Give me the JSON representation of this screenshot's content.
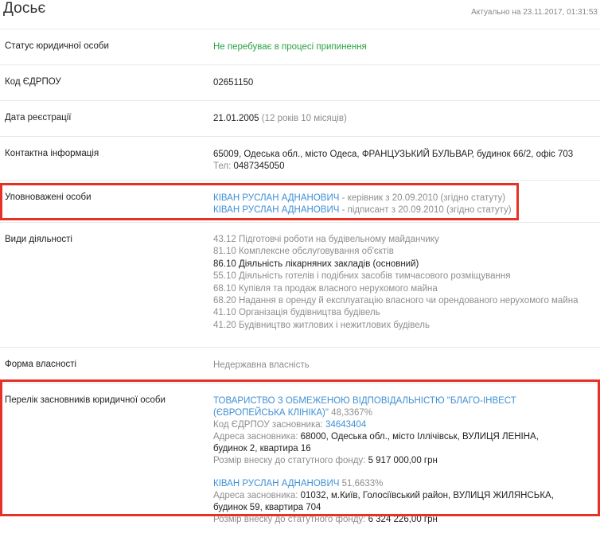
{
  "header": {
    "title": "Досьє",
    "updated": "Актуально на 23.11.2017, 01:31:53"
  },
  "rows": {
    "status": {
      "label": "Статус юридичної особи",
      "value": "Не перебуває в процесі припинення"
    },
    "code": {
      "label": "Код ЄДРПОУ",
      "value": "02651150"
    },
    "date": {
      "label": "Дата реєстрації",
      "value": "21.01.2005",
      "note": "(12 років 10 місяців)"
    },
    "contact": {
      "label": "Контактна інформація",
      "address": "65009, Одеська обл., місто Одеса, ФРАНЦУЗЬКИЙ БУЛЬВАР, будинок 66/2, офіс 703",
      "phone_label": "Тел:",
      "phone": "0487345050"
    },
    "authorized": {
      "label": "Уповноважені особи",
      "persons": [
        {
          "name": "КІВАН РУСЛАН АДНАНОВИЧ",
          "role": "- керівник з 20.09.2010 (згідно статуту)"
        },
        {
          "name": "КІВАН РУСЛАН АДНАНОВИЧ",
          "role": "- підписант з 20.09.2010 (згідно статуту)"
        }
      ]
    },
    "activities": {
      "label": "Види діяльності",
      "items": [
        {
          "text": "43.12 Підготовчі роботи на будівельному майданчику",
          "main": false
        },
        {
          "text": "81.10 Комплексне обслуговування об'єктів",
          "main": false
        },
        {
          "text": "86.10 Діяльність лікарняних закладів (основний)",
          "main": true
        },
        {
          "text": "55.10 Діяльність готелів і подібних засобів тимчасового розміщування",
          "main": false
        },
        {
          "text": "68.10 Купівля та продаж власного нерухомого майна",
          "main": false
        },
        {
          "text": "68.20 Надання в оренду й експлуатацію власного чи орендованого нерухомого майна",
          "main": false
        },
        {
          "text": "41.10 Організація будівництва будівель",
          "main": false
        },
        {
          "text": "41.20 Будівництво житлових і нежитлових будівель",
          "main": false
        }
      ]
    },
    "ownership": {
      "label": "Форма власності",
      "value": "Недержавна власність"
    },
    "founders": {
      "label": "Перелік засновників юридичної особи",
      "list": [
        {
          "name": "ТОВАРИСТВО З ОБМЕЖЕНОЮ ВІДПОВІДАЛЬНІСТЮ \"БЛАГО-ІНВЕСТ (ЄВРОПЕЙСЬКА КЛІНІКА)\"",
          "share": "48,3367%",
          "code_label": "Код ЄДРПОУ засновника:",
          "code": "34643404",
          "address_label": "Адреса засновника:",
          "address": "68000, Одеська обл., місто Іллічівськ, ВУЛИЦЯ ЛЕНІНА, будинок 2, квартира 16",
          "fund_label": "Розмір внеску до статутного фонду:",
          "fund": "5 917 000,00 грн"
        },
        {
          "name": "КІВАН РУСЛАН АДНАНОВИЧ",
          "share": "51,6633%",
          "address_label": "Адреса засновника:",
          "address": "01032, м.Київ, Голосіївський район, ВУЛИЦЯ ЖИЛЯНСЬКА, будинок 59, квартира 704",
          "fund_label": "Розмір внеску до статутного фонду:",
          "fund": "6 324 226,00 грн"
        }
      ]
    }
  },
  "highlight_color": "#e53224"
}
